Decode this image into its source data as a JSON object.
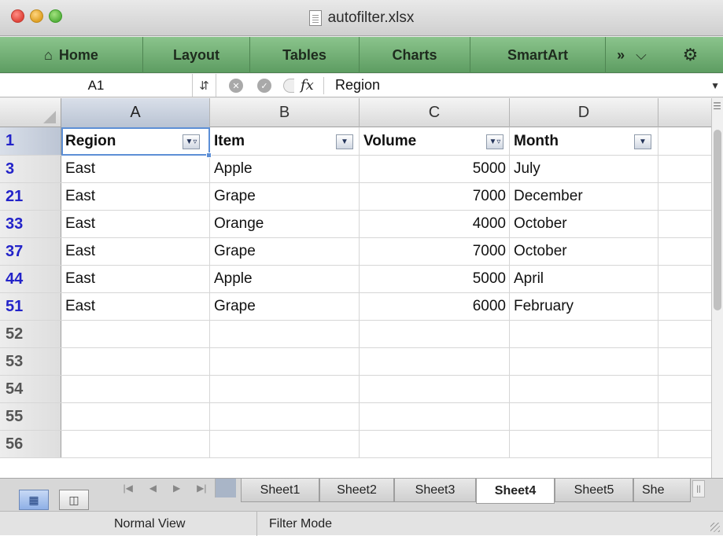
{
  "window": {
    "title": "autofilter.xlsx"
  },
  "ribbon": {
    "tabs": [
      {
        "label": "Home",
        "icon": "home-icon"
      },
      {
        "label": "Layout"
      },
      {
        "label": "Tables"
      },
      {
        "label": "Charts"
      },
      {
        "label": "SmartArt"
      }
    ],
    "overflow": "»",
    "dropdown": "⌵",
    "gear": "⚙"
  },
  "formula_bar": {
    "name_box": "A1",
    "fx_label": "fx",
    "value": "Region"
  },
  "columns": [
    "A",
    "B",
    "C",
    "D"
  ],
  "header_row": {
    "row_number": "1",
    "cells": [
      "Region",
      "Item",
      "Volume",
      "Month"
    ]
  },
  "rows": [
    {
      "row_number": "3",
      "region": "East",
      "item": "Apple",
      "volume": "5000",
      "month": "July"
    },
    {
      "row_number": "21",
      "region": "East",
      "item": "Grape",
      "volume": "7000",
      "month": "December"
    },
    {
      "row_number": "33",
      "region": "East",
      "item": "Orange",
      "volume": "4000",
      "month": "October"
    },
    {
      "row_number": "37",
      "region": "East",
      "item": "Grape",
      "volume": "7000",
      "month": "October"
    },
    {
      "row_number": "44",
      "region": "East",
      "item": "Apple",
      "volume": "5000",
      "month": "April"
    },
    {
      "row_number": "51",
      "region": "East",
      "item": "Grape",
      "volume": "6000",
      "month": "February"
    }
  ],
  "empty_rows": [
    "52",
    "53",
    "54",
    "55",
    "56"
  ],
  "sheets": {
    "tabs": [
      "Sheet1",
      "Sheet2",
      "Sheet3",
      "Sheet4",
      "Sheet5",
      "She"
    ],
    "active": "Sheet4"
  },
  "status_bar": {
    "view": "Normal View",
    "mode": "Filter Mode"
  },
  "colors": {
    "ribbon": "#6aa86d",
    "selection": "#5d8fd6",
    "filtered_row_number": "#2323c9"
  }
}
